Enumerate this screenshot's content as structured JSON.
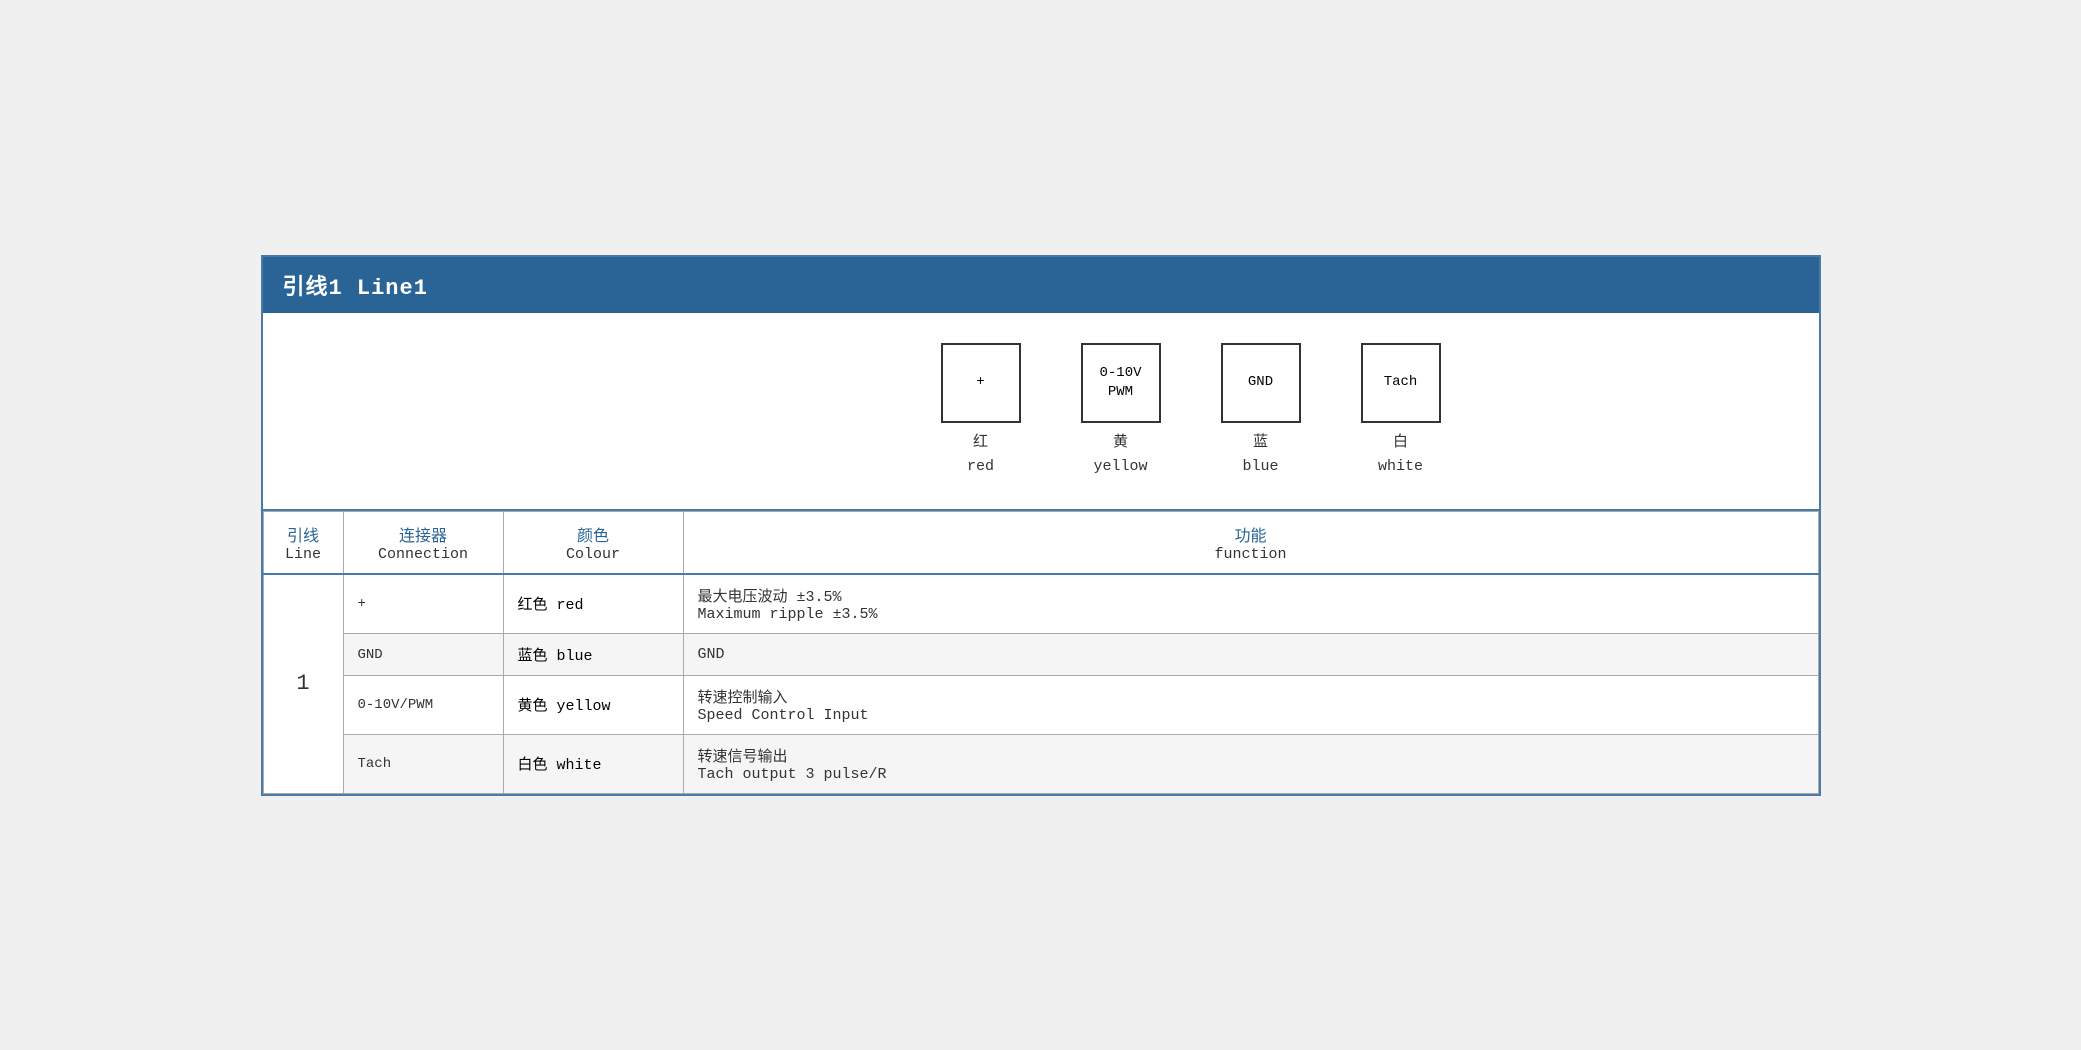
{
  "header": {
    "title": "引线1 Line1"
  },
  "diagram": {
    "connectors": [
      {
        "id": "plus",
        "label": "+",
        "color_cn": "红",
        "color_en": "red"
      },
      {
        "id": "pwm",
        "label": "0-10V\nPWM",
        "color_cn": "黄",
        "color_en": "yellow"
      },
      {
        "id": "gnd",
        "label": "GND",
        "color_cn": "蓝",
        "color_en": "blue"
      },
      {
        "id": "tach",
        "label": "Tach",
        "color_cn": "白",
        "color_en": "white"
      }
    ]
  },
  "table": {
    "headers": {
      "line_cn": "引线",
      "line_en": "Line",
      "conn_cn": "连接器",
      "conn_en": "Connection",
      "colour_cn": "颜色",
      "colour_en": "Colour",
      "func_cn": "功能",
      "func_en": "function"
    },
    "rows": [
      {
        "line": "1",
        "rowspan": 4,
        "connection": "+",
        "colour": "红色 red",
        "func_cn": "最大电压波动 ±3.5%",
        "func_en": "Maximum ripple ±3.5%",
        "alt": false
      },
      {
        "line": "",
        "connection": "GND",
        "colour": "蓝色 blue",
        "func_cn": "GND",
        "func_en": "",
        "alt": true
      },
      {
        "line": "",
        "connection": "0-10V/PWM",
        "colour": "黄色 yellow",
        "func_cn": "转速控制输入",
        "func_en": "Speed Control Input",
        "alt": false
      },
      {
        "line": "",
        "connection": "Tach",
        "colour": "白色 white",
        "func_cn": "转速信号输出",
        "func_en": "Tach output 3 pulse/R",
        "alt": true
      }
    ]
  }
}
